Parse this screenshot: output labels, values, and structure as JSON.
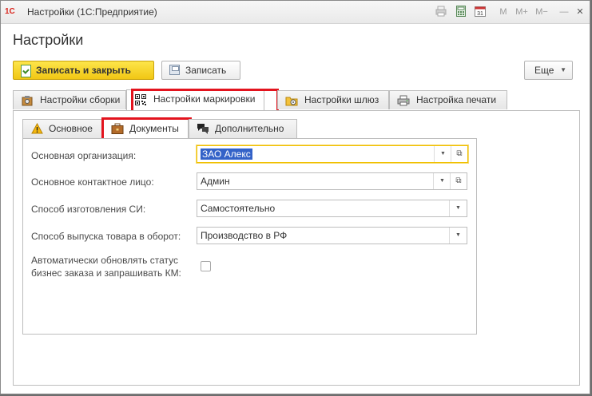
{
  "window": {
    "title": "Настройки  (1С:Предприятие)",
    "logo": "1С",
    "toolbar_icons": [
      "print-icon",
      "calculator-icon",
      "calendar-icon",
      "M",
      "M+",
      "M−",
      "minimize-icon",
      "close-icon"
    ],
    "toolbar_labels": {
      "m": "M",
      "m_plus": "M+",
      "m_minus": "M−",
      "min": "—",
      "close": "✕"
    }
  },
  "page": {
    "title": "Настройки"
  },
  "toolbar": {
    "save_close_label": "Записать и закрыть",
    "save_label": "Записать",
    "more_label": "Еще"
  },
  "outer_tabs": [
    {
      "label": "Настройки сборки",
      "icon": "assembly-icon"
    },
    {
      "label": "Настройки маркировки",
      "icon": "qr-code-icon",
      "active": true,
      "highlighted": true
    },
    {
      "label": "Настройки шлюз",
      "icon": "gateway-icon"
    },
    {
      "label": "Настройка печати",
      "icon": "printer-icon"
    }
  ],
  "inner_tabs": [
    {
      "label": "Основное",
      "icon": "warning-icon"
    },
    {
      "label": "Документы",
      "icon": "briefcase-icon",
      "active": true,
      "highlighted": true
    },
    {
      "label": "Дополнительно",
      "icon": "chat-icon"
    }
  ],
  "form": {
    "org_label": "Основная организация:",
    "org_value": "ЗАО Алекс",
    "contact_label": "Основное контактное лицо:",
    "contact_value": "Админ",
    "si_label": "Способ изготовления СИ:",
    "si_value": "Самостоятельно",
    "release_label": "Способ выпуска товара в оборот:",
    "release_value": "Производство в РФ",
    "auto_label_1": "Автоматически обновлять статус",
    "auto_label_2": "бизнес заказа и запрашивать КМ:",
    "auto_checked": false
  },
  "colors": {
    "primary_button": "#f5d22a",
    "highlight_box": "#e3141e",
    "selection": "#3362c8",
    "focus_border": "#f0c000"
  }
}
